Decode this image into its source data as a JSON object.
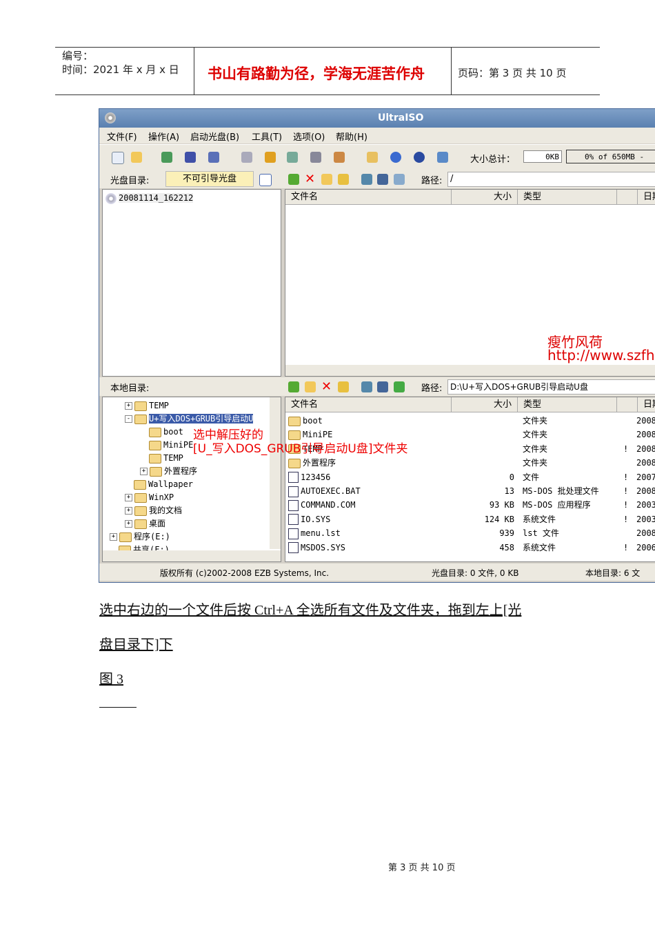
{
  "header": {
    "code_label": "编号：",
    "time_label": "时间：2021 年 x 月 x 日",
    "motto": "书山有路勤为径，学海无涯苦作舟",
    "page_info": "页码：第 3 页  共 10 页"
  },
  "window": {
    "title": "UltraISO",
    "menu": [
      "文件(F)",
      "操作(A)",
      "启动光盘(B)",
      "工具(T)",
      "选项(O)",
      "帮助(H)"
    ],
    "size_total_label": "大小总计：",
    "size_total_value": "0KB",
    "capacity": "0% of 650MB - ",
    "cd_dir_label": "光盘目录:",
    "boot_status": "不可引导光盘",
    "path_label": "路径:",
    "cd_path": "/",
    "cd_root": "20081114_162212",
    "columns": [
      "文件名",
      "大小",
      "类型",
      "日期"
    ],
    "local_dir_label": "本地目录:",
    "local_path": "D:\\U+写入DOS+GRUB引导启动U盘",
    "tree": [
      {
        "label": "TEMP",
        "indent": 1,
        "expander": "+"
      },
      {
        "label": "U+写入DOS+GRUB引导启动U",
        "indent": 1,
        "expander": "-",
        "selected": true
      },
      {
        "label": "boot",
        "indent": 2
      },
      {
        "label": "MiniPE",
        "indent": 2
      },
      {
        "label": "TEMP",
        "indent": 2
      },
      {
        "label": "外置程序",
        "indent": 2,
        "expander": "+"
      },
      {
        "label": "Wallpaper",
        "indent": 1
      },
      {
        "label": "WinXP",
        "indent": 1,
        "expander": "+"
      },
      {
        "label": "我的文档",
        "indent": 1,
        "expander": "+"
      },
      {
        "label": "桌面",
        "indent": 1,
        "expander": "+"
      },
      {
        "label": "程序(E:)",
        "indent": 0,
        "expander": "+"
      },
      {
        "label": "共享(F:)",
        "indent": 0
      }
    ],
    "files": [
      {
        "name": "boot",
        "size": "",
        "type": "文件夹",
        "flag": "",
        "date": "2008",
        "folder": true
      },
      {
        "name": "MiniPE",
        "size": "",
        "type": "文件夹",
        "flag": "",
        "date": "2008",
        "folder": true
      },
      {
        "name": "TEMP",
        "size": "",
        "type": "文件夹",
        "flag": "!",
        "date": "2008",
        "folder": true
      },
      {
        "name": "外置程序",
        "size": "",
        "type": "文件夹",
        "flag": "",
        "date": "2008",
        "folder": true
      },
      {
        "name": "123456",
        "size": "0",
        "type": "文件",
        "flag": "!",
        "date": "2007"
      },
      {
        "name": "AUTOEXEC.BAT",
        "size": "13",
        "type": "MS-DOS 批处理文件",
        "flag": "!",
        "date": "2008"
      },
      {
        "name": "COMMAND.COM",
        "size": "93 KB",
        "type": "MS-DOS 应用程序",
        "flag": "!",
        "date": "2003"
      },
      {
        "name": "IO.SYS",
        "size": "124 KB",
        "type": "系统文件",
        "flag": "!",
        "date": "2003"
      },
      {
        "name": "menu.lst",
        "size": "939",
        "type": "lst 文件",
        "flag": "",
        "date": "2008"
      },
      {
        "name": "MSDOS.SYS",
        "size": "458",
        "type": "系统文件",
        "flag": "!",
        "date": "2006"
      }
    ],
    "status": {
      "copyright": "版权所有 (c)2002-2008 EZB Systems, Inc.",
      "cd": "光盘目录: 0 文件, 0 KB",
      "local": "本地目录: 6 文"
    },
    "watermark": [
      "瘦竹风荷",
      "http://www.szfh"
    ],
    "annotation": [
      "选中解压好的",
      "[U_写入DOS_GRUB引导启动U盘]文件夹"
    ]
  },
  "body": {
    "line1": "选中右边的一个文件后按 Ctrl+A 全选所有文件及文件夹，拖到左上[光",
    "line2": "盘目录下]下",
    "caption": "图 3"
  },
  "footer": "第 3 页 共 10 页"
}
